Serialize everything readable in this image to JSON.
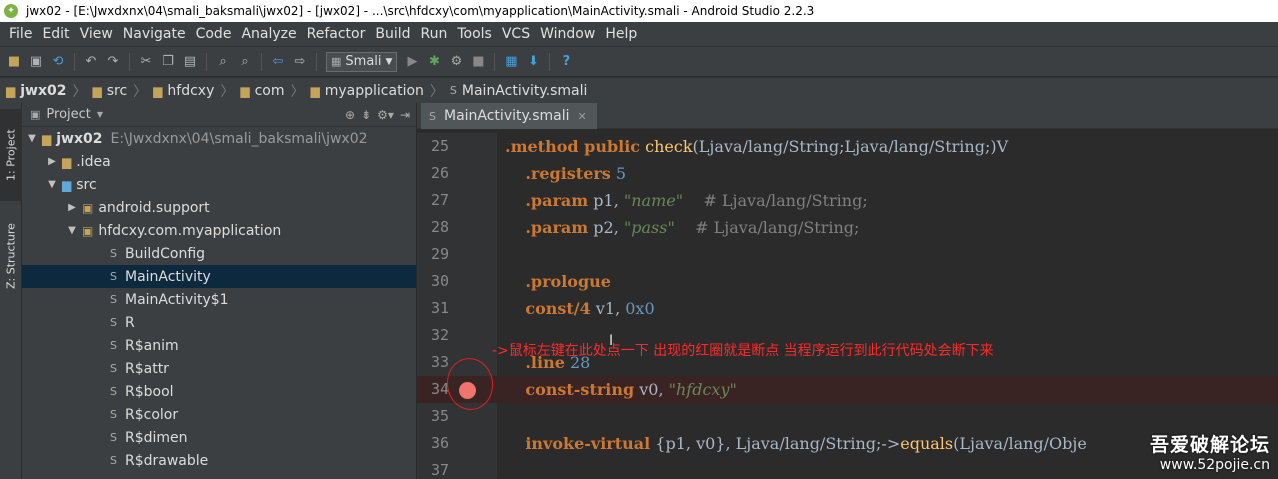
{
  "title_bar": {
    "text": "jwx02 - [E:\\Jwxdxnx\\04\\smali_baksmali\\jwx02] - [jwx02] - ...\\src\\hfdcxy\\com\\myapplication\\MainActivity.smali - Android Studio 2.2.3"
  },
  "menu": {
    "items": [
      "File",
      "Edit",
      "View",
      "Navigate",
      "Code",
      "Analyze",
      "Refactor",
      "Build",
      "Run",
      "Tools",
      "VCS",
      "Window",
      "Help"
    ]
  },
  "toolbar": {
    "run_config": "Smali"
  },
  "breadcrumbs": {
    "items": [
      "jwx02",
      "src",
      "hfdcxy",
      "com",
      "myapplication",
      "MainActivity.smali"
    ]
  },
  "side_tabs": {
    "project": "1: Project",
    "structure": "Z: Structure"
  },
  "project_panel": {
    "header": "Project",
    "root": {
      "name": "jwx02",
      "path": "E:\\Jwxdxnx\\04\\smali_baksmali\\jwx02"
    },
    "tree": [
      {
        "label": ".idea",
        "kind": "folder"
      },
      {
        "label": "src",
        "kind": "folder"
      },
      {
        "label": "android.support",
        "kind": "package"
      },
      {
        "label": "hfdcxy.com.myapplication",
        "kind": "package"
      },
      {
        "label": "BuildConfig",
        "kind": "smali"
      },
      {
        "label": "MainActivity",
        "kind": "smali",
        "selected": true
      },
      {
        "label": "MainActivity$1",
        "kind": "smali"
      },
      {
        "label": "R",
        "kind": "smali"
      },
      {
        "label": "R$anim",
        "kind": "smali"
      },
      {
        "label": "R$attr",
        "kind": "smali"
      },
      {
        "label": "R$bool",
        "kind": "smali"
      },
      {
        "label": "R$color",
        "kind": "smali"
      },
      {
        "label": "R$dimen",
        "kind": "smali"
      },
      {
        "label": "R$drawable",
        "kind": "smali"
      }
    ]
  },
  "editor": {
    "tab_label": "MainActivity.smali",
    "lines": [
      {
        "num": "25",
        "text": ".method public check(Ljava/lang/String;Ljava/lang/String;)V"
      },
      {
        "num": "26",
        "text": "    .registers 5"
      },
      {
        "num": "27",
        "text": "    .param p1, \"name\"    # Ljava/lang/String;"
      },
      {
        "num": "28",
        "text": "    .param p2, \"pass\"    # Ljava/lang/String;"
      },
      {
        "num": "29",
        "text": ""
      },
      {
        "num": "30",
        "text": "    .prologue"
      },
      {
        "num": "31",
        "text": "    const/4 v1, 0x0"
      },
      {
        "num": "32",
        "text": ""
      },
      {
        "num": "33",
        "text": "    .line 28"
      },
      {
        "num": "34",
        "text": "    const-string v0, \"hfdcxy\"",
        "breakpoint": true
      },
      {
        "num": "35",
        "text": ""
      },
      {
        "num": "36",
        "text": "    invoke-virtual {p1, v0}, Ljava/lang/String;->equals(Ljava/lang/Obje"
      },
      {
        "num": "37",
        "text": ""
      }
    ]
  },
  "annotation": {
    "text": "->鼠标左键在此处点一下 出现的红圈就是断点 当程序运行到此行代码处会断下来"
  },
  "watermark": {
    "title": "吾爱破解论坛",
    "url": "www.52pojie.cn"
  },
  "colors": {
    "annotation": "#ff2a2a",
    "breakpoint": "#f0736e",
    "keyword": "#cc7832",
    "string": "#6a8759",
    "number": "#6897bb",
    "selection": "#0d293e"
  }
}
